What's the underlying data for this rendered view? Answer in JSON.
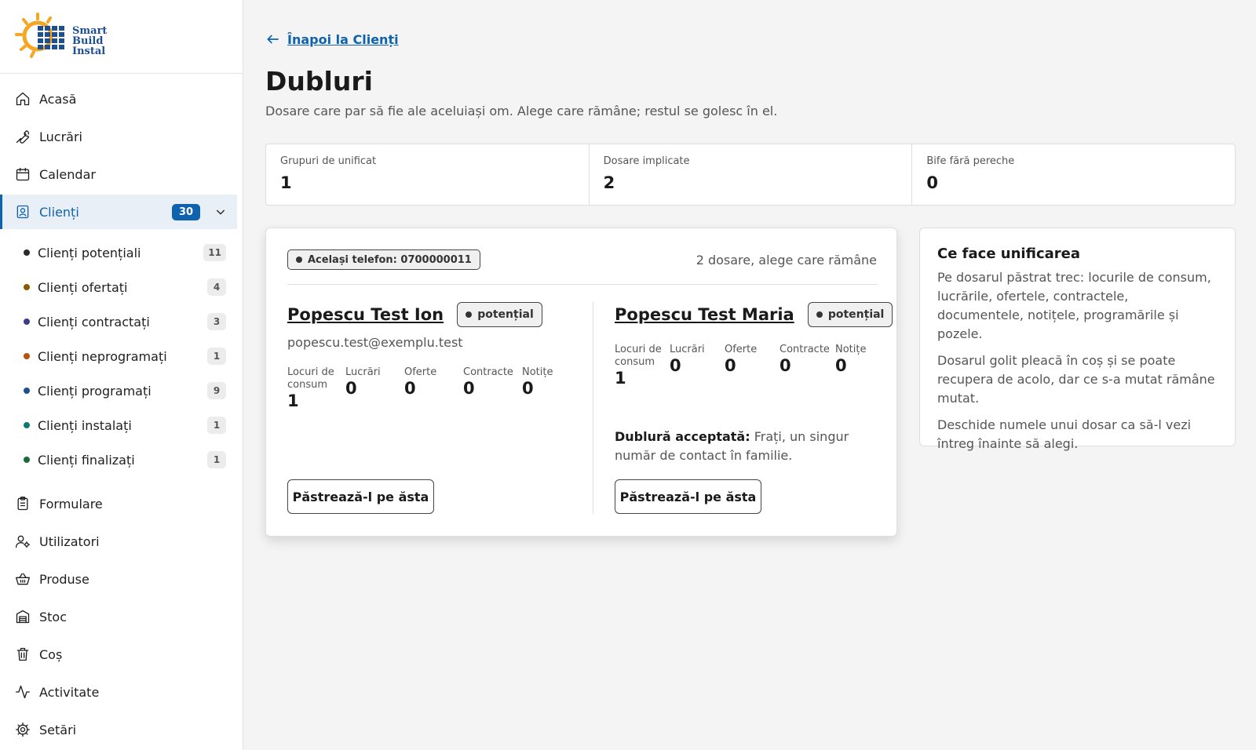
{
  "brand": {
    "logo_lines": [
      "Smart",
      "Build",
      "Instal"
    ]
  },
  "sidebar": {
    "items": [
      {
        "label": "Acasă",
        "icon": "home-icon"
      },
      {
        "label": "Lucrări",
        "icon": "wrench-icon"
      },
      {
        "label": "Calendar",
        "icon": "calendar-icon"
      },
      {
        "label": "Clienți",
        "icon": "contact-icon",
        "count": "30",
        "active": true
      },
      {
        "label": "Formulare",
        "icon": "clipboard-icon"
      },
      {
        "label": "Utilizatori",
        "icon": "user-cog-icon"
      },
      {
        "label": "Produse",
        "icon": "basket-icon"
      },
      {
        "label": "Stoc",
        "icon": "warehouse-icon"
      },
      {
        "label": "Coș",
        "icon": "trash-icon"
      },
      {
        "label": "Activitate",
        "icon": "activity-icon"
      },
      {
        "label": "Setări",
        "icon": "gear-icon"
      }
    ],
    "clients_sub": [
      {
        "label": "Clienți potențiali",
        "count": "11",
        "color": "#2b2b2b"
      },
      {
        "label": "Clienți ofertați",
        "count": "4",
        "color": "#8a5a00"
      },
      {
        "label": "Clienți contractați",
        "count": "3",
        "color": "#3d3b8e"
      },
      {
        "label": "Clienți neprogramați",
        "count": "1",
        "color": "#b5530f"
      },
      {
        "label": "Clienți programați",
        "count": "9",
        "color": "#1d4f91"
      },
      {
        "label": "Clienți instalați",
        "count": "1",
        "color": "#0e7a6b"
      },
      {
        "label": "Clienți finalizați",
        "count": "1",
        "color": "#1b6b3a"
      }
    ]
  },
  "page": {
    "back_label": "Înapoi la Clienți",
    "title": "Dubluri",
    "subtitle": "Dosare care par să fie ale aceluiași om. Alege care rămâne; restul se golesc în el."
  },
  "stats": [
    {
      "label": "Grupuri de unificat",
      "value": "1"
    },
    {
      "label": "Dosare implicate",
      "value": "2"
    },
    {
      "label": "Bife fără pereche",
      "value": "0"
    }
  ],
  "group": {
    "reason": "Același telefon: 0700000011",
    "hint": "2 dosare, alege care rămâne",
    "clients": [
      {
        "name": "Popescu Test Ion",
        "status": "potențial",
        "email": "popescu.test@exemplu.test",
        "metrics": [
          {
            "label": "Locuri de consum",
            "value": "1"
          },
          {
            "label": "Lucrări",
            "value": "0"
          },
          {
            "label": "Oferte",
            "value": "0"
          },
          {
            "label": "Contracte",
            "value": "0"
          },
          {
            "label": "Notițe",
            "value": "0"
          }
        ],
        "keep_label": "Păstrează-l pe ăsta"
      },
      {
        "name": "Popescu Test Maria",
        "status": "potențial",
        "metrics": [
          {
            "label": "Locuri de consum",
            "value": "1"
          },
          {
            "label": "Lucrări",
            "value": "0"
          },
          {
            "label": "Oferte",
            "value": "0"
          },
          {
            "label": "Contracte",
            "value": "0"
          },
          {
            "label": "Notițe",
            "value": "0"
          }
        ],
        "note_bold": "Dublură acceptată:",
        "note_text": " Frați, un singur număr de contact în familie.",
        "keep_label": "Păstrează-l pe ăsta"
      }
    ]
  },
  "info": {
    "title": "Ce face unificarea",
    "paragraphs": [
      "Pe dosarul păstrat trec: locurile de consum, lucrările, ofertele, contractele, documentele, notițele, programările și pozele.",
      "Dosarul golit pleacă în coș și se poate recupera de acolo, dar ce s-a mutat rămâne mutat.",
      "Deschide numele unui dosar ca să-l vezi întreg înainte să alegi."
    ]
  },
  "colors": {
    "accent": "#0f62ae",
    "logo_sun": "#f5a623",
    "logo_text": "#1d4f91"
  }
}
